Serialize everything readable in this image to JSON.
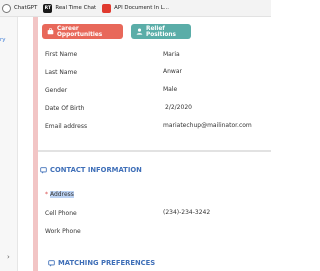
{
  "bookmarks": [
    {
      "label": "ChatGPT",
      "icon": "chatgpt-icon"
    },
    {
      "label": "Real Time Chat",
      "icon": "realtime-chat-icon",
      "glyph": "RT"
    },
    {
      "label": "API Document In L...",
      "icon": "api-document-icon"
    }
  ],
  "sidebar": {
    "fragment": "ry"
  },
  "actions": {
    "career": {
      "label": "Career Opportunities",
      "color": "#e8685a",
      "icon": "briefcase-icon"
    },
    "relief": {
      "label": "Relief Positions",
      "color": "#5aada8",
      "icon": "user-icon"
    }
  },
  "personal": {
    "fields": [
      {
        "label": "First Name",
        "value": "Maria"
      },
      {
        "label": "Last Name",
        "value": "Anwar"
      },
      {
        "label": "Gender",
        "value": "Male"
      },
      {
        "label": "Date Of Birth",
        "value": "2/2/2020"
      },
      {
        "label": "Email address",
        "value": "mariatechup@mailinator.com"
      }
    ]
  },
  "contact": {
    "title": "CONTACT INFORMATION",
    "address_label": "Address",
    "cell_label": "Cell Phone",
    "cell_value": "(234)-234-3242",
    "work_label": "Work Phone"
  },
  "matching": {
    "title": "MATCHING PREFERENCES"
  },
  "colors": {
    "section": "#3f6fb8",
    "accent": "#f2c5c5"
  }
}
